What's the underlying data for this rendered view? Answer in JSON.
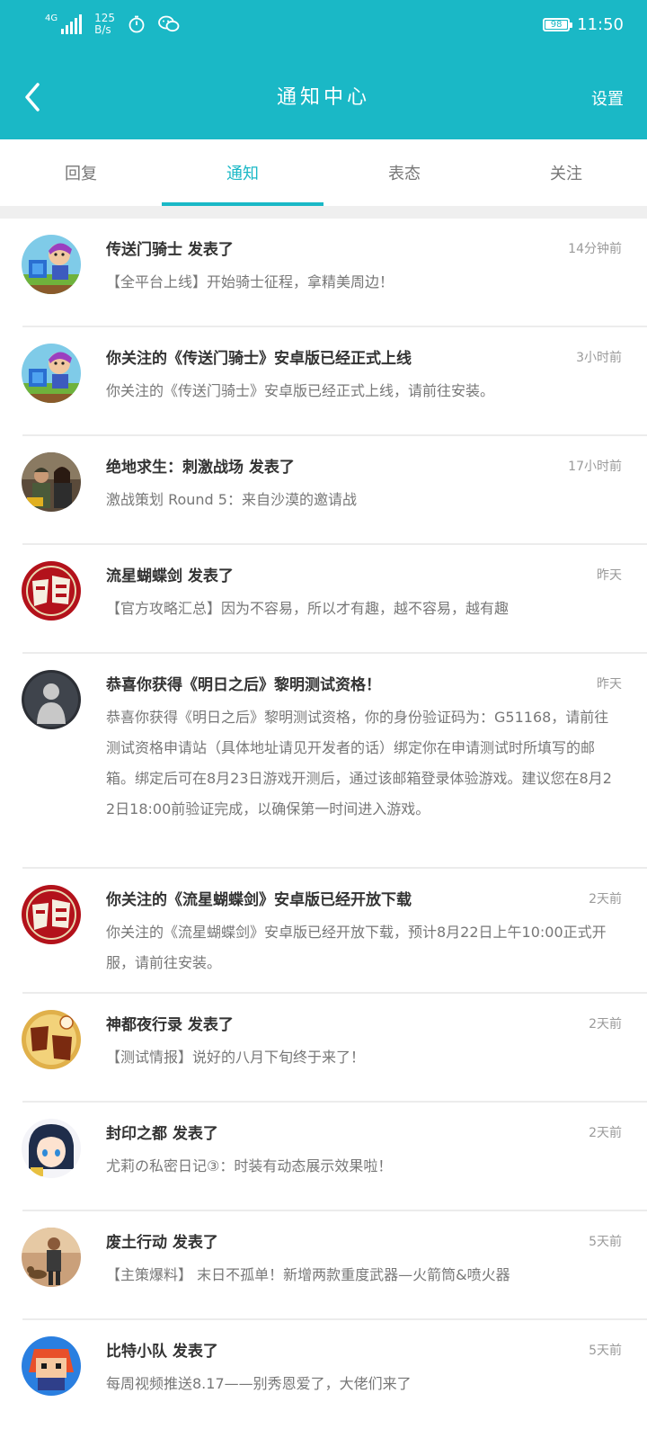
{
  "status_bar": {
    "network": "4G",
    "speed_value": "125",
    "speed_unit": "B/s",
    "battery": "98",
    "time": "11:50",
    "icons": [
      "signal-icon",
      "timer-icon",
      "wechat-icon",
      "battery-icon"
    ]
  },
  "header": {
    "title": "通知中心",
    "back_icon": "chevron-left-icon",
    "settings_label": "设置"
  },
  "tabs": [
    {
      "label": "回复",
      "active": false
    },
    {
      "label": "通知",
      "active": true
    },
    {
      "label": "表态",
      "active": false
    },
    {
      "label": "关注",
      "active": false
    }
  ],
  "colors": {
    "accent": "#1ab8c6",
    "title_text": "#333333",
    "body_text": "#777777",
    "time_text": "#9a9a9a"
  },
  "notifications": [
    {
      "title": "传送门骑士 发表了",
      "time": "14分钟前",
      "body": "【全平台上线】开始骑士征程，拿精美周边！",
      "avatar": "portal-knights-game-icon"
    },
    {
      "title": "你关注的《传送门骑士》安卓版已经正式上线",
      "time": "3小时前",
      "body": "你关注的《传送门骑士》安卓版已经正式上线，请前往安装。",
      "avatar": "portal-knights-game-icon"
    },
    {
      "title": "绝地求生：刺激战场 发表了",
      "time": "17小时前",
      "body": "激战策划 Round 5：来自沙漠的邀请战",
      "avatar": "pubg-mobile-game-icon"
    },
    {
      "title": "流星蝴蝶剑 发表了",
      "time": "昨天",
      "body": "【官方攻略汇总】因为不容易，所以才有趣，越不容易，越有趣",
      "avatar": "meteor-butterfly-sword-game-icon"
    },
    {
      "title": "恭喜你获得《明日之后》黎明测试资格！",
      "time": "昨天",
      "body": "恭喜你获得《明日之后》黎明测试资格，你的身份验证码为：G51168，请前往测试资格申请站（具体地址请见开发者的话）绑定你在申请测试时所填写的邮箱。绑定后可在8月23日游戏开测后，通过该邮箱登录体验游戏。建议您在8月22日18:00前验证完成，以确保第一时间进入游戏。",
      "avatar": "silhouette-avatar-icon"
    },
    {
      "title": "你关注的《流星蝴蝶剑》安卓版已经开放下载",
      "time": "2天前",
      "body": "你关注的《流星蝴蝶剑》安卓版已经开放下载，预计8月22日上午10:00正式开服，请前往安装。",
      "avatar": "meteor-butterfly-sword-game-icon"
    },
    {
      "title": "神都夜行录 发表了",
      "time": "2天前",
      "body": "【测试情报】说好的八月下旬终于来了！",
      "avatar": "shendu-night-game-icon"
    },
    {
      "title": "封印之都 发表了",
      "time": "2天前",
      "body": "尤莉の私密日记③：时装有动态展示效果啦！",
      "avatar": "anime-girl-game-icon"
    },
    {
      "title": "废土行动 发表了",
      "time": "5天前",
      "body": "【主策爆料】 末日不孤单！新增两款重度武器—火箭筒&喷火器",
      "avatar": "wasteland-soldier-game-icon"
    },
    {
      "title": "比特小队 发表了",
      "time": "5天前",
      "body": "每周视频推送8.17——别秀恩爱了，大佬们来了",
      "avatar": "bit-squad-game-icon"
    }
  ]
}
